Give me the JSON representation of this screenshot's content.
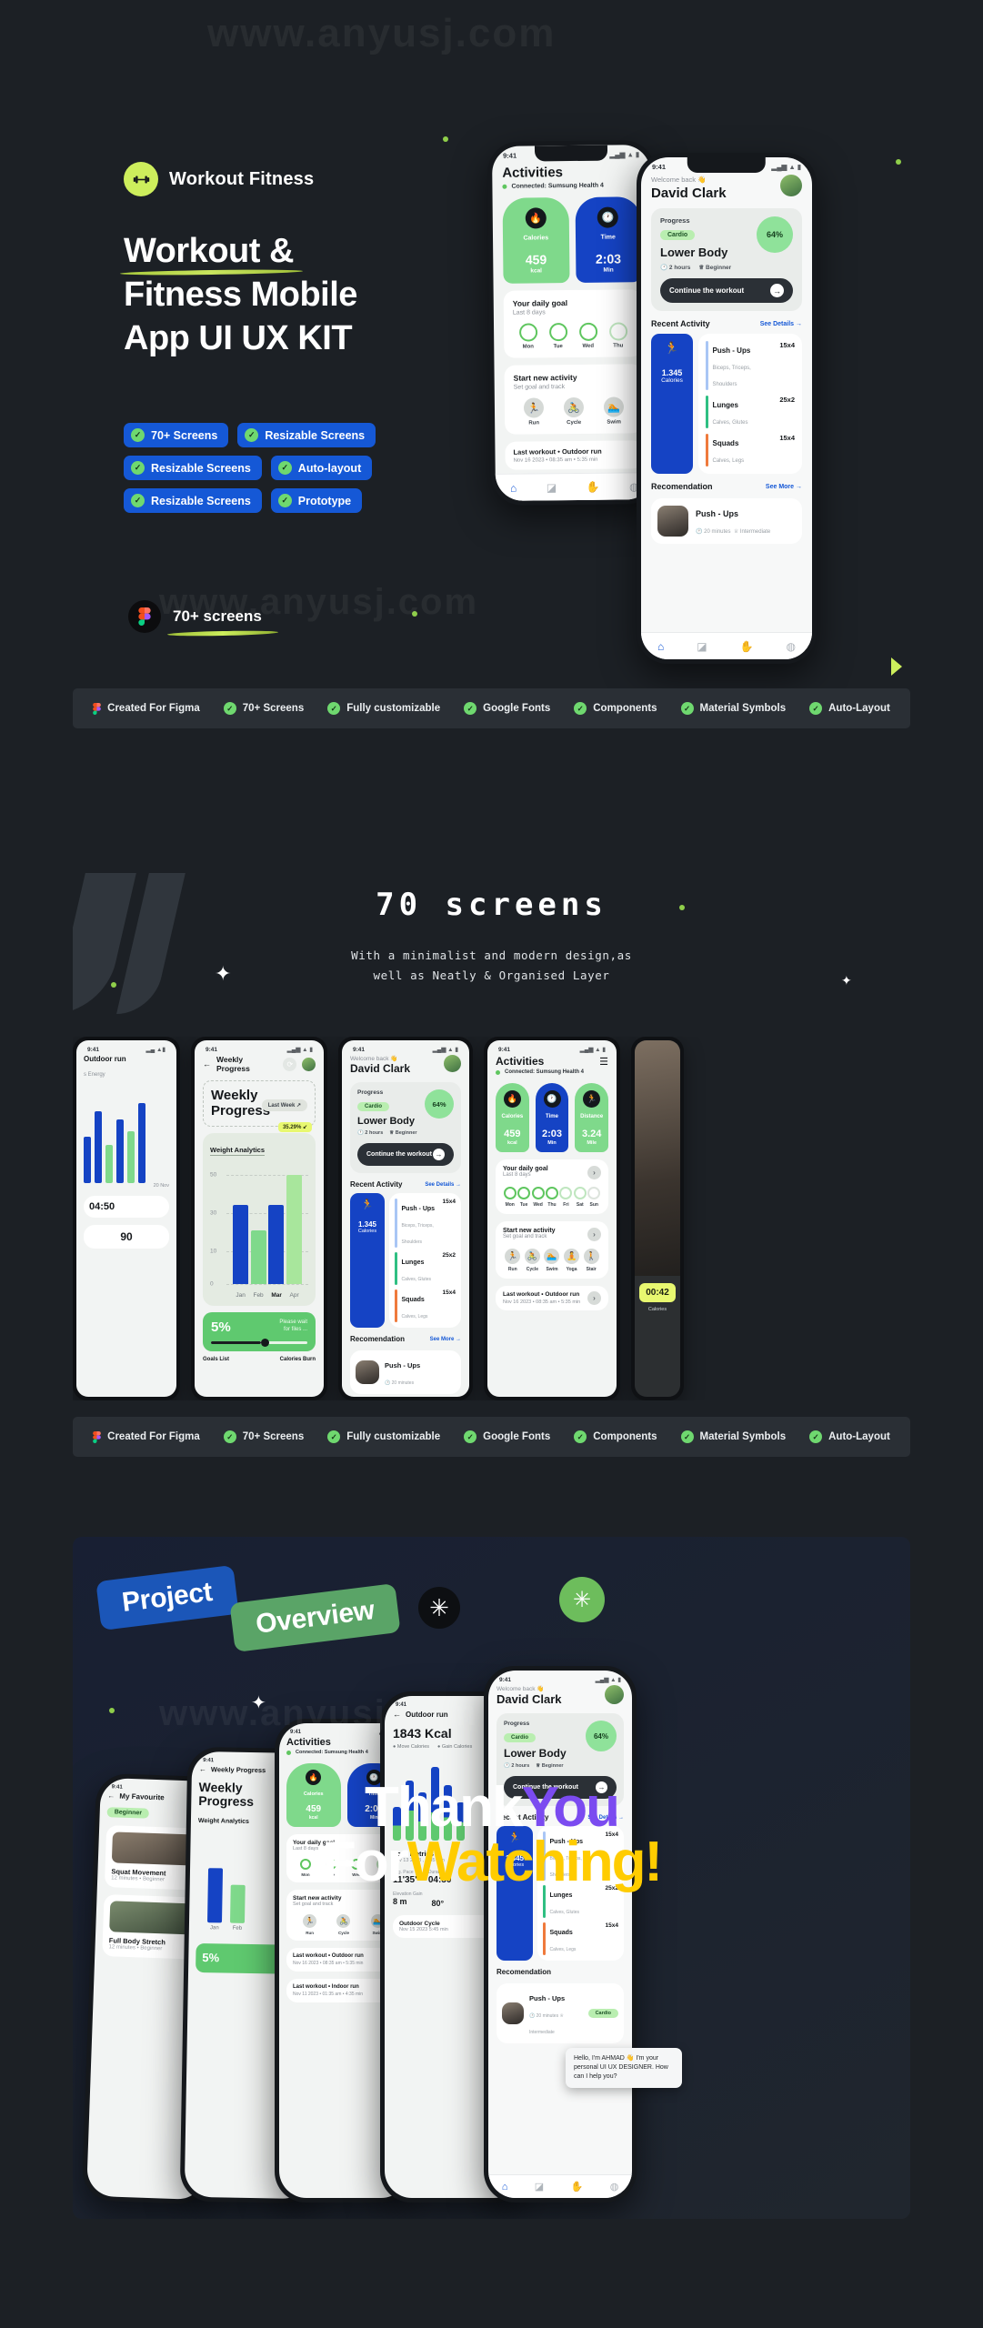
{
  "brand": {
    "logo_icon": "dumbbell-icon",
    "name": "Workout Fitness",
    "accent_green": "#cdee5c",
    "accent_blue": "#1558d6"
  },
  "hero": {
    "title_line1": "Workout &",
    "title_line2": "Fitness  Mobile",
    "title_line3": "App UI UX KIT",
    "badges": [
      {
        "label": "70+ Screens"
      },
      {
        "label": "Resizable Screens"
      },
      {
        "label": "Resizable Screens"
      },
      {
        "label": "Auto-layout"
      },
      {
        "label": "Resizable Screens"
      },
      {
        "label": "Prototype"
      }
    ],
    "figma_label": "70+ screens",
    "figma_icon": "figma-icon"
  },
  "feature_strip": [
    {
      "label": "Created For Figma",
      "icon": "figma-icon"
    },
    {
      "label": "70+ Screens",
      "icon": "check-icon"
    },
    {
      "label": "Fully customizable",
      "icon": "check-icon"
    },
    {
      "label": "Google Fonts",
      "icon": "check-icon"
    },
    {
      "label": "Components",
      "icon": "check-icon"
    },
    {
      "label": "Material Symbols",
      "icon": "check-icon"
    },
    {
      "label": "Auto-Layout",
      "icon": "check-icon"
    }
  ],
  "section70": {
    "heading": "70 screens",
    "subtitle_line1": "With a minimalist and modern design,as",
    "subtitle_line2": "well as Neatly & Organised Layer"
  },
  "promo": {
    "badge_project": "Project",
    "badge_overview": "Overview",
    "thanks_line1_a": "Thank",
    "thanks_line1_b": "You",
    "thanks_line2_a": "For",
    "thanks_line2_b": "Watching!",
    "chat_text": "Hello, I'm AHMAD 👋 I'm your personal UI UX DESIGNER. How can I help you?",
    "colors": {
      "you": "#7b4bf0",
      "watching": "#ffcc00"
    }
  },
  "screens": {
    "activities": {
      "time": "9:41",
      "title": "Activities",
      "connected": "Connected: Sumsung Health 4",
      "stats": [
        {
          "icon": "flame-icon",
          "label": "Calories",
          "value": "459",
          "unit": "kcal",
          "color": "green"
        },
        {
          "icon": "clock-icon",
          "label": "Time",
          "value": "2:03",
          "unit": "Min",
          "color": "blue"
        },
        {
          "icon": "run-icon",
          "label": "Distance",
          "value": "3.24",
          "unit": "Mile",
          "color": "green"
        }
      ],
      "daily_goal_title": "Your daily goal",
      "daily_goal_sub": "Last 8 days",
      "days": [
        "Mon",
        "Tue",
        "Wed",
        "Thu",
        "Fri",
        "Sat",
        "Sun"
      ],
      "new_activity_title": "Start new activity",
      "new_activity_sub": "Set goal and track",
      "activities": [
        {
          "label": "Run",
          "icon": "run-icon"
        },
        {
          "label": "Cycle",
          "icon": "bike-icon"
        },
        {
          "label": "Swim",
          "icon": "swim-icon"
        },
        {
          "label": "Yoga",
          "icon": "yoga-icon"
        },
        {
          "label": "Stair",
          "icon": "stair-icon"
        }
      ],
      "last_workout_title": "Last workout • Outdoor run",
      "last_workout_sub": "Nov 16  2023 • 08:35 am • 5:35 min",
      "last_workout2_title": "Last workout • Indoor run",
      "last_workout2_sub": "Nov 11  2023 • 01:35 am • 4:35 min"
    },
    "home": {
      "time": "9:41",
      "welcome": "Welcome back 👋",
      "user": "David Clark",
      "progress_label": "Progress",
      "tag": "Cardio",
      "workout": "Lower Body",
      "duration": "2 hours",
      "level": "Beginner",
      "percent": "64%",
      "cta": "Continue the workout",
      "recent_title": "Recent Activity",
      "see_details": "See Details →",
      "calories_value": "1.345",
      "calories_label": "Calories",
      "exercises": [
        {
          "name": "Push - Ups",
          "muscles": "Biceps, Triceps, Shoulders",
          "reps": "15x4",
          "color": "#a9c6f5"
        },
        {
          "name": "Lunges",
          "muscles": "Calves, Glutes",
          "reps": "25x2",
          "color": "#2fbf82"
        },
        {
          "name": "Squads",
          "muscles": "Calves, Legs",
          "reps": "15x4",
          "color": "#ef7a3c"
        }
      ],
      "reco_title": "Recomendation",
      "see_more": "See More →",
      "reco": [
        {
          "name": "Push - Ups",
          "time": "20 minutes",
          "level": "Intermediate"
        }
      ],
      "nav": [
        "home-icon",
        "chart-icon",
        "hand-icon",
        "profile-icon"
      ]
    },
    "weekly": {
      "time": "9:41",
      "nav_title": "Weekly Progress",
      "heading_a": "Weekly",
      "heading_b": "Progress",
      "range": "Last Week ↗",
      "delta": "35.29%",
      "chart_title": "Weight Analytics",
      "progress_percent": "5%",
      "progress_note_a": "Please wait",
      "progress_note_b": "for files ...",
      "footer_a": "Goals List",
      "footer_b": "Calories Burn"
    },
    "run": {
      "title": "Outdoor run",
      "kcal": "1843 Kcal",
      "legend_a": "Move Calories",
      "legend_b": "Gain Calories",
      "metrics_title": "Your Metrics",
      "metrics_date": "Nov 13 2023 , 5:45 min",
      "avg_label": "Avg. Pace",
      "avg_value": "11'35\"",
      "dur_label": "Duration",
      "dur_value": "04:50",
      "elev_label": "Elevation Gain",
      "elev_value": "8 m",
      "deg_value": "80°",
      "cycle_title": "Outdoor Cycle",
      "cycle_date": "Nov 15 2023  5:45 min"
    },
    "timer": {
      "value": "00:42",
      "label": "Calories"
    },
    "favourite": {
      "nav": "My Favourite",
      "tag": "Beginner",
      "item1": "Squat Movement",
      "item1_sub": "12 minutes • Beginner",
      "item2": "Full Body Stretch",
      "item2_sub": "12 minutes • Beginner"
    }
  },
  "chart_data": {
    "type": "bar",
    "title": "Weight Analytics",
    "categories": [
      "Jan",
      "Feb",
      "Mar",
      "Apr"
    ],
    "values": [
      34,
      23,
      34,
      47
    ],
    "colors": [
      "#1543c4",
      "#7fd98b",
      "#1543c4",
      "#a8e69c"
    ],
    "ylim": [
      0,
      50
    ],
    "yticks": [
      0,
      10,
      30,
      50
    ],
    "xlabel": "",
    "ylabel": "",
    "grid": true,
    "legend": "none"
  },
  "watermarks": [
    "www.anyusj.com",
    "www.anyusj.com",
    "www.anyusj.com"
  ]
}
